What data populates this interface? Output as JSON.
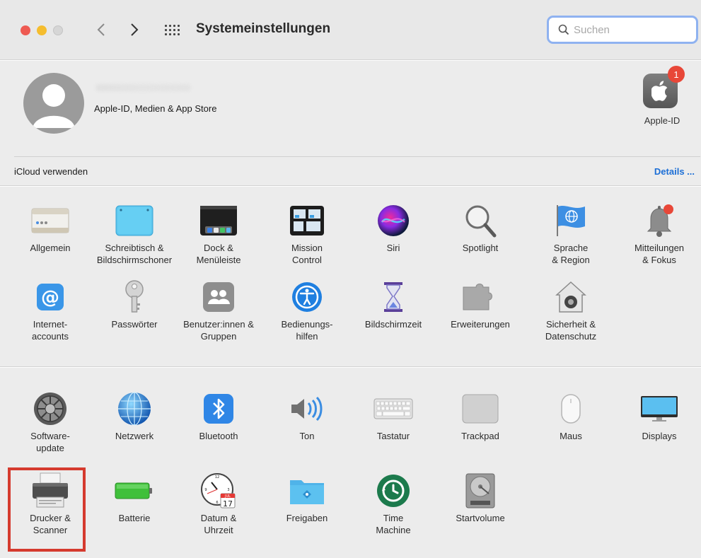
{
  "window": {
    "title": "Systemeinstellungen"
  },
  "search": {
    "placeholder": "Suchen"
  },
  "account": {
    "subtitle": "Apple-ID, Medien & App Store",
    "appleid_label": "Apple-ID",
    "badge_count": "1",
    "icloud_label": "iCloud verwenden",
    "details_link": "Details ..."
  },
  "section1": [
    {
      "label": "Allgemein",
      "icon": "general-icon"
    },
    {
      "label": "Schreibtisch &\nBildschirmschoner",
      "icon": "desktop-icon"
    },
    {
      "label": "Dock &\nMenüleiste",
      "icon": "dock-icon"
    },
    {
      "label": "Mission\nControl",
      "icon": "mission-control-icon"
    },
    {
      "label": "Siri",
      "icon": "siri-icon"
    },
    {
      "label": "Spotlight",
      "icon": "spotlight-icon"
    },
    {
      "label": "Sprache\n& Region",
      "icon": "language-region-icon"
    },
    {
      "label": "Mitteilungen\n& Fokus",
      "icon": "notifications-icon"
    },
    {
      "label": "Internet-\naccounts",
      "icon": "internet-accounts-icon"
    },
    {
      "label": "Passwörter",
      "icon": "passwords-icon"
    },
    {
      "label": "Benutzer:innen &\nGruppen",
      "icon": "users-groups-icon"
    },
    {
      "label": "Bedienungs-\nhilfen",
      "icon": "accessibility-icon"
    },
    {
      "label": "Bildschirmzeit",
      "icon": "screen-time-icon"
    },
    {
      "label": "Erweiterungen",
      "icon": "extensions-icon"
    },
    {
      "label": "Sicherheit &\nDatenschutz",
      "icon": "security-privacy-icon"
    }
  ],
  "section2": [
    {
      "label": "Software-\nupdate",
      "icon": "software-update-icon"
    },
    {
      "label": "Netzwerk",
      "icon": "network-icon"
    },
    {
      "label": "Bluetooth",
      "icon": "bluetooth-icon"
    },
    {
      "label": "Ton",
      "icon": "sound-icon"
    },
    {
      "label": "Tastatur",
      "icon": "keyboard-icon"
    },
    {
      "label": "Trackpad",
      "icon": "trackpad-icon"
    },
    {
      "label": "Maus",
      "icon": "mouse-icon"
    },
    {
      "label": "Displays",
      "icon": "displays-icon"
    },
    {
      "label": "Drucker &\nScanner",
      "icon": "printer-icon"
    },
    {
      "label": "Batterie",
      "icon": "battery-icon"
    },
    {
      "label": "Datum &\nUhrzeit",
      "icon": "date-time-icon"
    },
    {
      "label": "Freigaben",
      "icon": "sharing-icon"
    },
    {
      "label": "Time\nMachine",
      "icon": "time-machine-icon"
    },
    {
      "label": "Startvolume",
      "icon": "startup-disk-icon"
    }
  ],
  "calendar_icon": {
    "month": "JUL",
    "day": "17"
  },
  "colors": {
    "highlight": "#d53a2e",
    "link": "#1b6ed6",
    "focus_ring": "#8fb2f0"
  }
}
